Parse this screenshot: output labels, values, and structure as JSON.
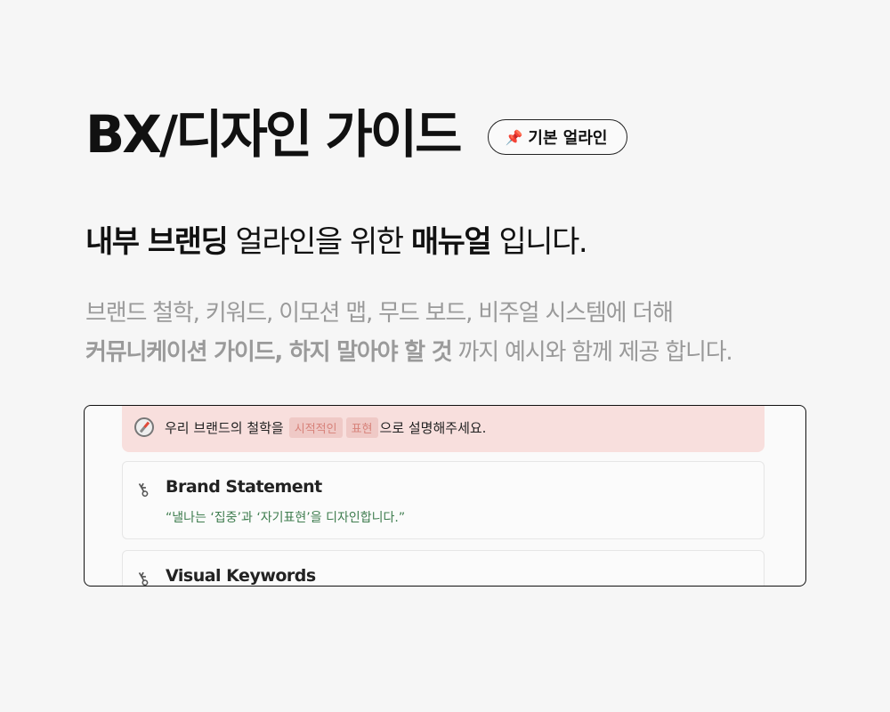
{
  "header": {
    "title": "BX/디자인 가이드",
    "badge": {
      "icon": "pushpin-icon",
      "label": "기본 얼라인"
    }
  },
  "headline": {
    "part1": "내부 브랜딩",
    "part2": " 얼라인을 위한 ",
    "part3": "매뉴얼",
    "part4": " 입니다."
  },
  "description": {
    "line1": "브랜드 철학, 키워드, 이모션 맵, 무드 보드, 비주얼 시스템에 더해",
    "line2_bold": "커뮤니케이션 가이드, 하지 말아야 할 것",
    "line2_rest": " 까지 예시와 함께 제공 합니다."
  },
  "preview": {
    "callout": {
      "icon": "compass-icon",
      "text_before": "우리 브랜드의 철학을",
      "tag1": "시적적인",
      "tag2": "표현",
      "text_after": "으로 설명해주세요."
    },
    "cards": [
      {
        "icon": "key-icon",
        "title": "Brand Statement",
        "quote": "“낼나는 ‘집중’과 ‘자기표현’을 디자인합니다.”"
      },
      {
        "icon": "key-icon",
        "title": "Visual Keywords"
      }
    ]
  },
  "colors": {
    "background": "#f6f6f6",
    "callout": "#f8dfdd",
    "quote": "#3f7d4f"
  }
}
